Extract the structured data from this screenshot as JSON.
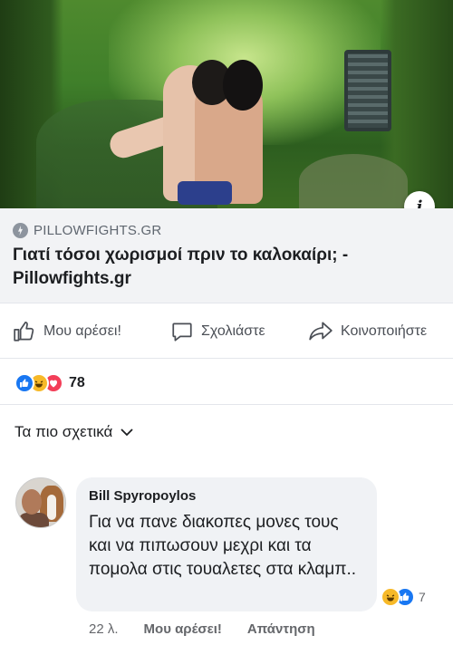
{
  "post": {
    "link_domain": "PILLOWFIGHTS.GR",
    "link_title": "Γιατί τόσοι χωρισμοί πριν το καλοκαίρι; - Pillowfights.gr"
  },
  "actions": {
    "like": "Μου αρέσει!",
    "comment": "Σχολιάστε",
    "share": "Κοινοποιήστε"
  },
  "reactions": {
    "types": [
      "like",
      "haha",
      "love"
    ],
    "count": "78"
  },
  "comments_filter": {
    "label": "Τα πιο σχετικά"
  },
  "comment": {
    "author": "Bill Spyropoylos",
    "text": "Για να πανε διακοπες μονες τους και να πιπωσουν μεχρι και τα πομολα στις τουαλετες στα κλαμπ..",
    "reaction_count": "7",
    "time": "22 λ.",
    "like_label": "Μου αρέσει!",
    "reply_label": "Απάντηση"
  },
  "colors": {
    "like_blue": "#1877f2",
    "haha_yellow": "#f7b928",
    "love_red": "#f33e58"
  }
}
